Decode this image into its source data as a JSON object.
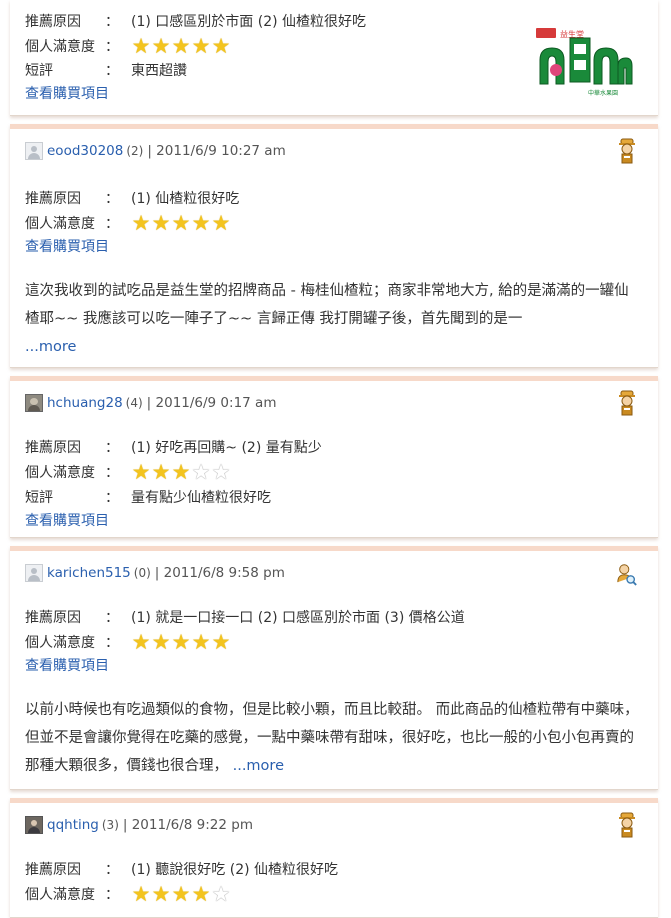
{
  "labels": {
    "reason": "推薦原因",
    "satisfaction": "個人滿意度",
    "short_review": "短評",
    "colon": "：",
    "view_purchase": "查看購買項目",
    "more": "...more"
  },
  "colors": {
    "link": "#2a5fae",
    "star": "#f3c41e",
    "card_border": "#f7d9c9",
    "logo_green": "#1a8a3a"
  },
  "reviews": [
    {
      "reason": "(1) 口感區別於市面   (2) 仙楂粒很好吃",
      "rating": 5,
      "short_review": "東西超讚",
      "logo_caption": "中華水果園",
      "logo_text": "田"
    },
    {
      "username": "eood30208",
      "count": "(2)",
      "date": "| 2011/6/9  10:27 am",
      "badge": "worker-badge-icon",
      "reason": "(1) 仙楂粒很好吃",
      "rating": 5,
      "body": "這次我收到的試吃品是益生堂的招牌商品 - 梅桂仙楂粒；商家非常地大方, 給的是滿滿的一罐仙楂耶~~ 我應該可以吃一陣子了~~   言歸正傳  我打開罐子後，首先聞到的是一"
    },
    {
      "username": "hchuang28",
      "count": "(4)",
      "date": "| 2011/6/9  0:17 am",
      "badge": "worker-badge-icon",
      "reason": "(1) 好吃再回購~   (2) 量有點少",
      "rating": 3,
      "short_review": "量有點少仙楂粒很好吃"
    },
    {
      "username": "karichen515",
      "count": "(0)",
      "date": "| 2011/6/8  9:58 pm",
      "badge": "newbie-search-icon",
      "reason": "(1) 就是一口接一口   (2) 口感區別於市面   (3) 價格公道",
      "rating": 5,
      "body": "以前小時候也有吃過類似的食物，但是比較小顆，而且比較甜。 而此商品的仙楂粒帶有中藥味，但並不是會讓你覺得在吃藥的感覺，一點中藥味帶有甜味，很好吃，也比一般的小包小包再賣的那種大顆很多，價錢也很合理，  "
    },
    {
      "username": "qqhting",
      "count": "(3)",
      "date": "| 2011/6/8  9:22 pm",
      "badge": "worker-badge-icon",
      "reason": "(1) 聽說很好吃   (2) 仙楂粒很好吃",
      "rating": 4
    }
  ]
}
